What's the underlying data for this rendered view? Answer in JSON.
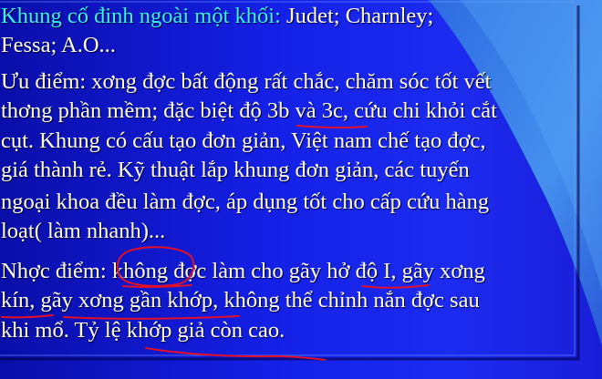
{
  "slide": {
    "heading": {
      "label": "Khung cố đinh ngoài một khối:",
      "authors_part1": " Judet; Charnley;",
      "authors_part2": "Fessa; A.O..."
    },
    "advantages": {
      "lines": [
        " Ưu điểm: xơng đợc bất động rất chắc, chăm sóc tốt vết",
        "thơng phần mềm; đặc biệt độ 3b và 3c, cứu chi khỏi cắt",
        "cụt. Khung có cấu tạo đơn giản, Việt nam chế tạo đợc,",
        "giá thành rẻ. Kỹ thuật lắp khung đơn giản, các tuyến",
        "ngoại khoa đều làm đợc, áp dụng tốt cho cấp cứu hàng",
        "loạt( làm nhanh)..."
      ]
    },
    "disadvantages": {
      "lines": [
        "Nhợc điểm: không đợc làm cho gãy hở độ I, gãy xơng",
        "kín, gãy xơng gần khớp, không thể chỉnh nắn đợc sau",
        "khi mổ. Tỷ lệ khớp giả còn cao."
      ]
    },
    "colors": {
      "background": "#1420e6",
      "text": "#ffffff",
      "heading": "#3df0ff",
      "annotation": "#e0102a",
      "swoosh": "#3e8ee8"
    }
  }
}
